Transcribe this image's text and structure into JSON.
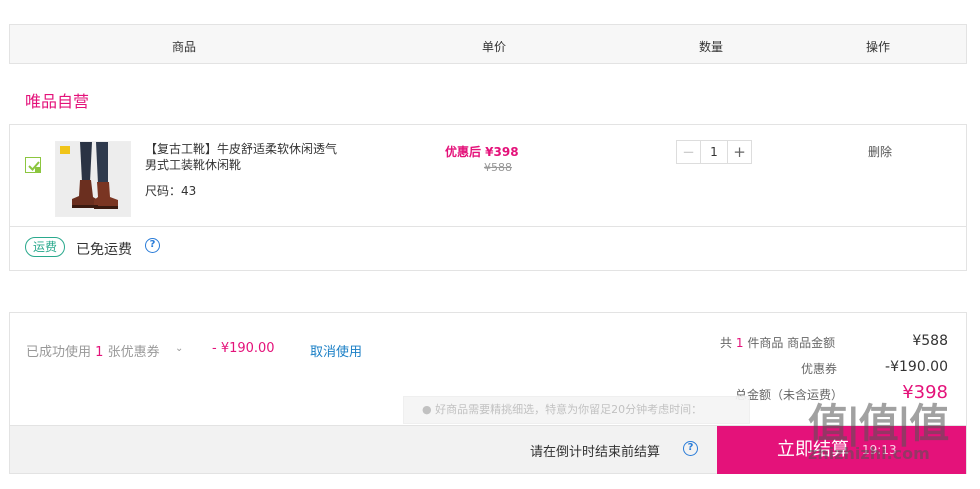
{
  "table_header": {
    "product": "商品",
    "unit_price": "单价",
    "quantity": "数量",
    "actions": "操作"
  },
  "shop": {
    "name": "唯品自营"
  },
  "item": {
    "checked": true,
    "title": "【复古工靴】牛皮舒适柔软休闲透气男式工装靴休闲靴",
    "size_label": "尺码：43",
    "price_now": "优惠后 ¥398",
    "price_original": "¥588",
    "quantity": "1",
    "minus_label": "−",
    "plus_label": "+",
    "delete_label": "删除"
  },
  "shipping": {
    "badge": "运费",
    "text": "已免运费",
    "help": "?"
  },
  "coupon": {
    "prefix": "已成功使用",
    "count": "1",
    "suffix": "张优惠券",
    "chevron": "⌄",
    "amount": "- ¥190.00",
    "cancel_label": "取消使用"
  },
  "summary": {
    "count_prefix": "共",
    "count": "1",
    "count_suffix": "件商品  商品金额",
    "goods_amount": "¥588",
    "discount_label": "优惠券",
    "discount_amount": "-¥190.00",
    "total_label": "总金额（未含运费）",
    "total_amount": "¥398"
  },
  "tooltip": {
    "text": "● 好商品需要精挑细选，特意为你留足20分钟考虑时间："
  },
  "footer": {
    "countdown_text": "请在倒计时结束前结算",
    "help": "?",
    "checkout_label": "立即结算",
    "timer": "19:13"
  },
  "watermark": {
    "big": "值|值|值",
    "site": "zhizhizhi.com"
  },
  "colors": {
    "brand": "#e4127a",
    "link": "#1a7fc6",
    "shipping_badge": "#2aa98d",
    "help_icon": "#2a7cd8"
  }
}
